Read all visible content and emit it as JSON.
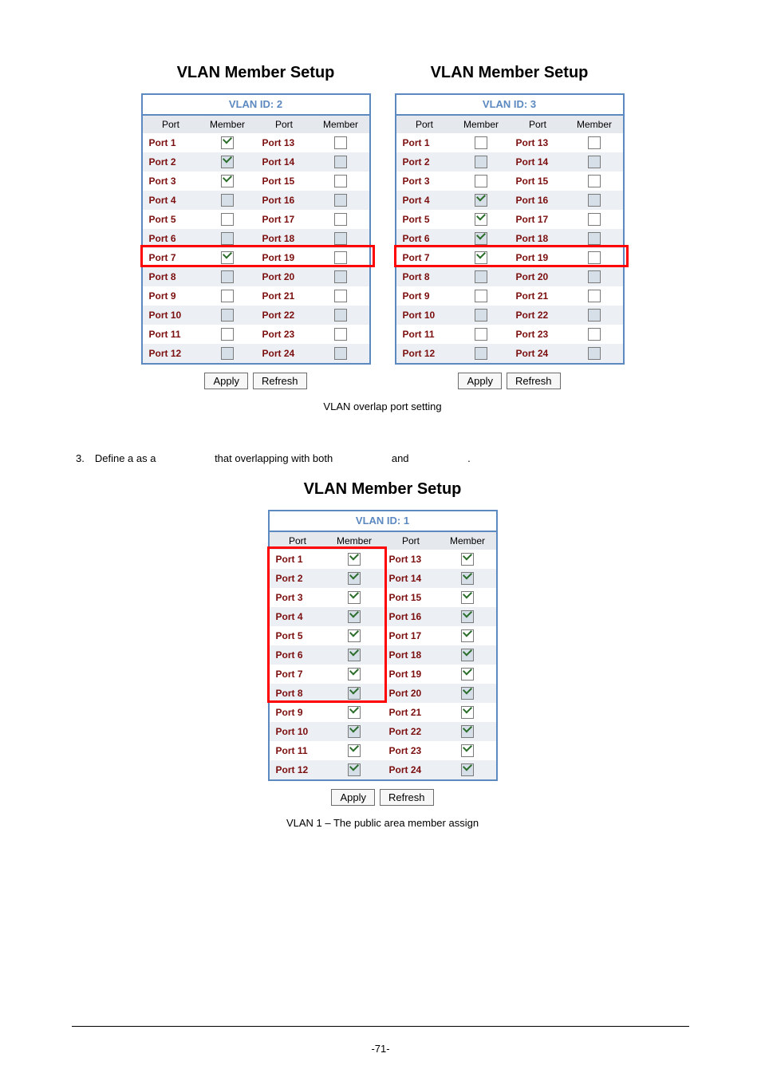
{
  "titles": {
    "top_left": "VLAN Member Setup",
    "top_right": "VLAN Member Setup",
    "bottom": "VLAN Member Setup"
  },
  "captions": {
    "overlap": "VLAN overlap port setting",
    "public": "VLAN 1 – The public area member assign"
  },
  "instruction": {
    "prefix": "3. Define a ",
    "middle1": " as a ",
    "middle2": " that overlapping with both ",
    "middle3": " and ",
    "tail": " ."
  },
  "headers": {
    "port": "Port",
    "member": "Member"
  },
  "buttons": {
    "apply": "Apply",
    "refresh": "Refresh"
  },
  "page_num": "-71-",
  "panels": {
    "p2": {
      "id_line": "VLAN ID: 2"
    },
    "p3": {
      "id_line": "VLAN ID: 3"
    },
    "p1": {
      "id_line": "VLAN ID: 1"
    }
  },
  "port_labels": [
    "Port 1",
    "Port 2",
    "Port 3",
    "Port 4",
    "Port 5",
    "Port 6",
    "Port 7",
    "Port 8",
    "Port 9",
    "Port 10",
    "Port 11",
    "Port 12",
    "Port 13",
    "Port 14",
    "Port 15",
    "Port 16",
    "Port 17",
    "Port 18",
    "Port 19",
    "Port 20",
    "Port 21",
    "Port 22",
    "Port 23",
    "Port 24"
  ],
  "chart_data": [
    {
      "type": "table",
      "title": "VLAN ID: 2",
      "columns": [
        "Port",
        "Member"
      ],
      "rows": [
        [
          "Port 1",
          true
        ],
        [
          "Port 2",
          true
        ],
        [
          "Port 3",
          true
        ],
        [
          "Port 4",
          false
        ],
        [
          "Port 5",
          false
        ],
        [
          "Port 6",
          false
        ],
        [
          "Port 7",
          true
        ],
        [
          "Port 8",
          false
        ],
        [
          "Port 9",
          false
        ],
        [
          "Port 10",
          false
        ],
        [
          "Port 11",
          false
        ],
        [
          "Port 12",
          false
        ],
        [
          "Port 13",
          false
        ],
        [
          "Port 14",
          false
        ],
        [
          "Port 15",
          false
        ],
        [
          "Port 16",
          false
        ],
        [
          "Port 17",
          false
        ],
        [
          "Port 18",
          false
        ],
        [
          "Port 19",
          false
        ],
        [
          "Port 20",
          false
        ],
        [
          "Port 21",
          false
        ],
        [
          "Port 22",
          false
        ],
        [
          "Port 23",
          false
        ],
        [
          "Port 24",
          false
        ]
      ],
      "highlight_row_index": 6
    },
    {
      "type": "table",
      "title": "VLAN ID: 3",
      "columns": [
        "Port",
        "Member"
      ],
      "rows": [
        [
          "Port 1",
          false
        ],
        [
          "Port 2",
          false
        ],
        [
          "Port 3",
          false
        ],
        [
          "Port 4",
          true
        ],
        [
          "Port 5",
          true
        ],
        [
          "Port 6",
          true
        ],
        [
          "Port 7",
          true
        ],
        [
          "Port 8",
          false
        ],
        [
          "Port 9",
          false
        ],
        [
          "Port 10",
          false
        ],
        [
          "Port 11",
          false
        ],
        [
          "Port 12",
          false
        ],
        [
          "Port 13",
          false
        ],
        [
          "Port 14",
          false
        ],
        [
          "Port 15",
          false
        ],
        [
          "Port 16",
          false
        ],
        [
          "Port 17",
          false
        ],
        [
          "Port 18",
          false
        ],
        [
          "Port 19",
          false
        ],
        [
          "Port 20",
          false
        ],
        [
          "Port 21",
          false
        ],
        [
          "Port 22",
          false
        ],
        [
          "Port 23",
          false
        ],
        [
          "Port 24",
          false
        ]
      ],
      "highlight_row_index": 6
    },
    {
      "type": "table",
      "title": "VLAN ID: 1",
      "columns": [
        "Port",
        "Member"
      ],
      "rows": [
        [
          "Port 1",
          true
        ],
        [
          "Port 2",
          true
        ],
        [
          "Port 3",
          true
        ],
        [
          "Port 4",
          true
        ],
        [
          "Port 5",
          true
        ],
        [
          "Port 6",
          true
        ],
        [
          "Port 7",
          true
        ],
        [
          "Port 8",
          true
        ],
        [
          "Port 9",
          true
        ],
        [
          "Port 10",
          true
        ],
        [
          "Port 11",
          true
        ],
        [
          "Port 12",
          true
        ],
        [
          "Port 13",
          true
        ],
        [
          "Port 14",
          true
        ],
        [
          "Port 15",
          true
        ],
        [
          "Port 16",
          true
        ],
        [
          "Port 17",
          true
        ],
        [
          "Port 18",
          true
        ],
        [
          "Port 19",
          true
        ],
        [
          "Port 20",
          true
        ],
        [
          "Port 21",
          true
        ],
        [
          "Port 22",
          true
        ],
        [
          "Port 23",
          true
        ],
        [
          "Port 24",
          true
        ]
      ],
      "highlight_range": [
        0,
        7
      ]
    }
  ]
}
